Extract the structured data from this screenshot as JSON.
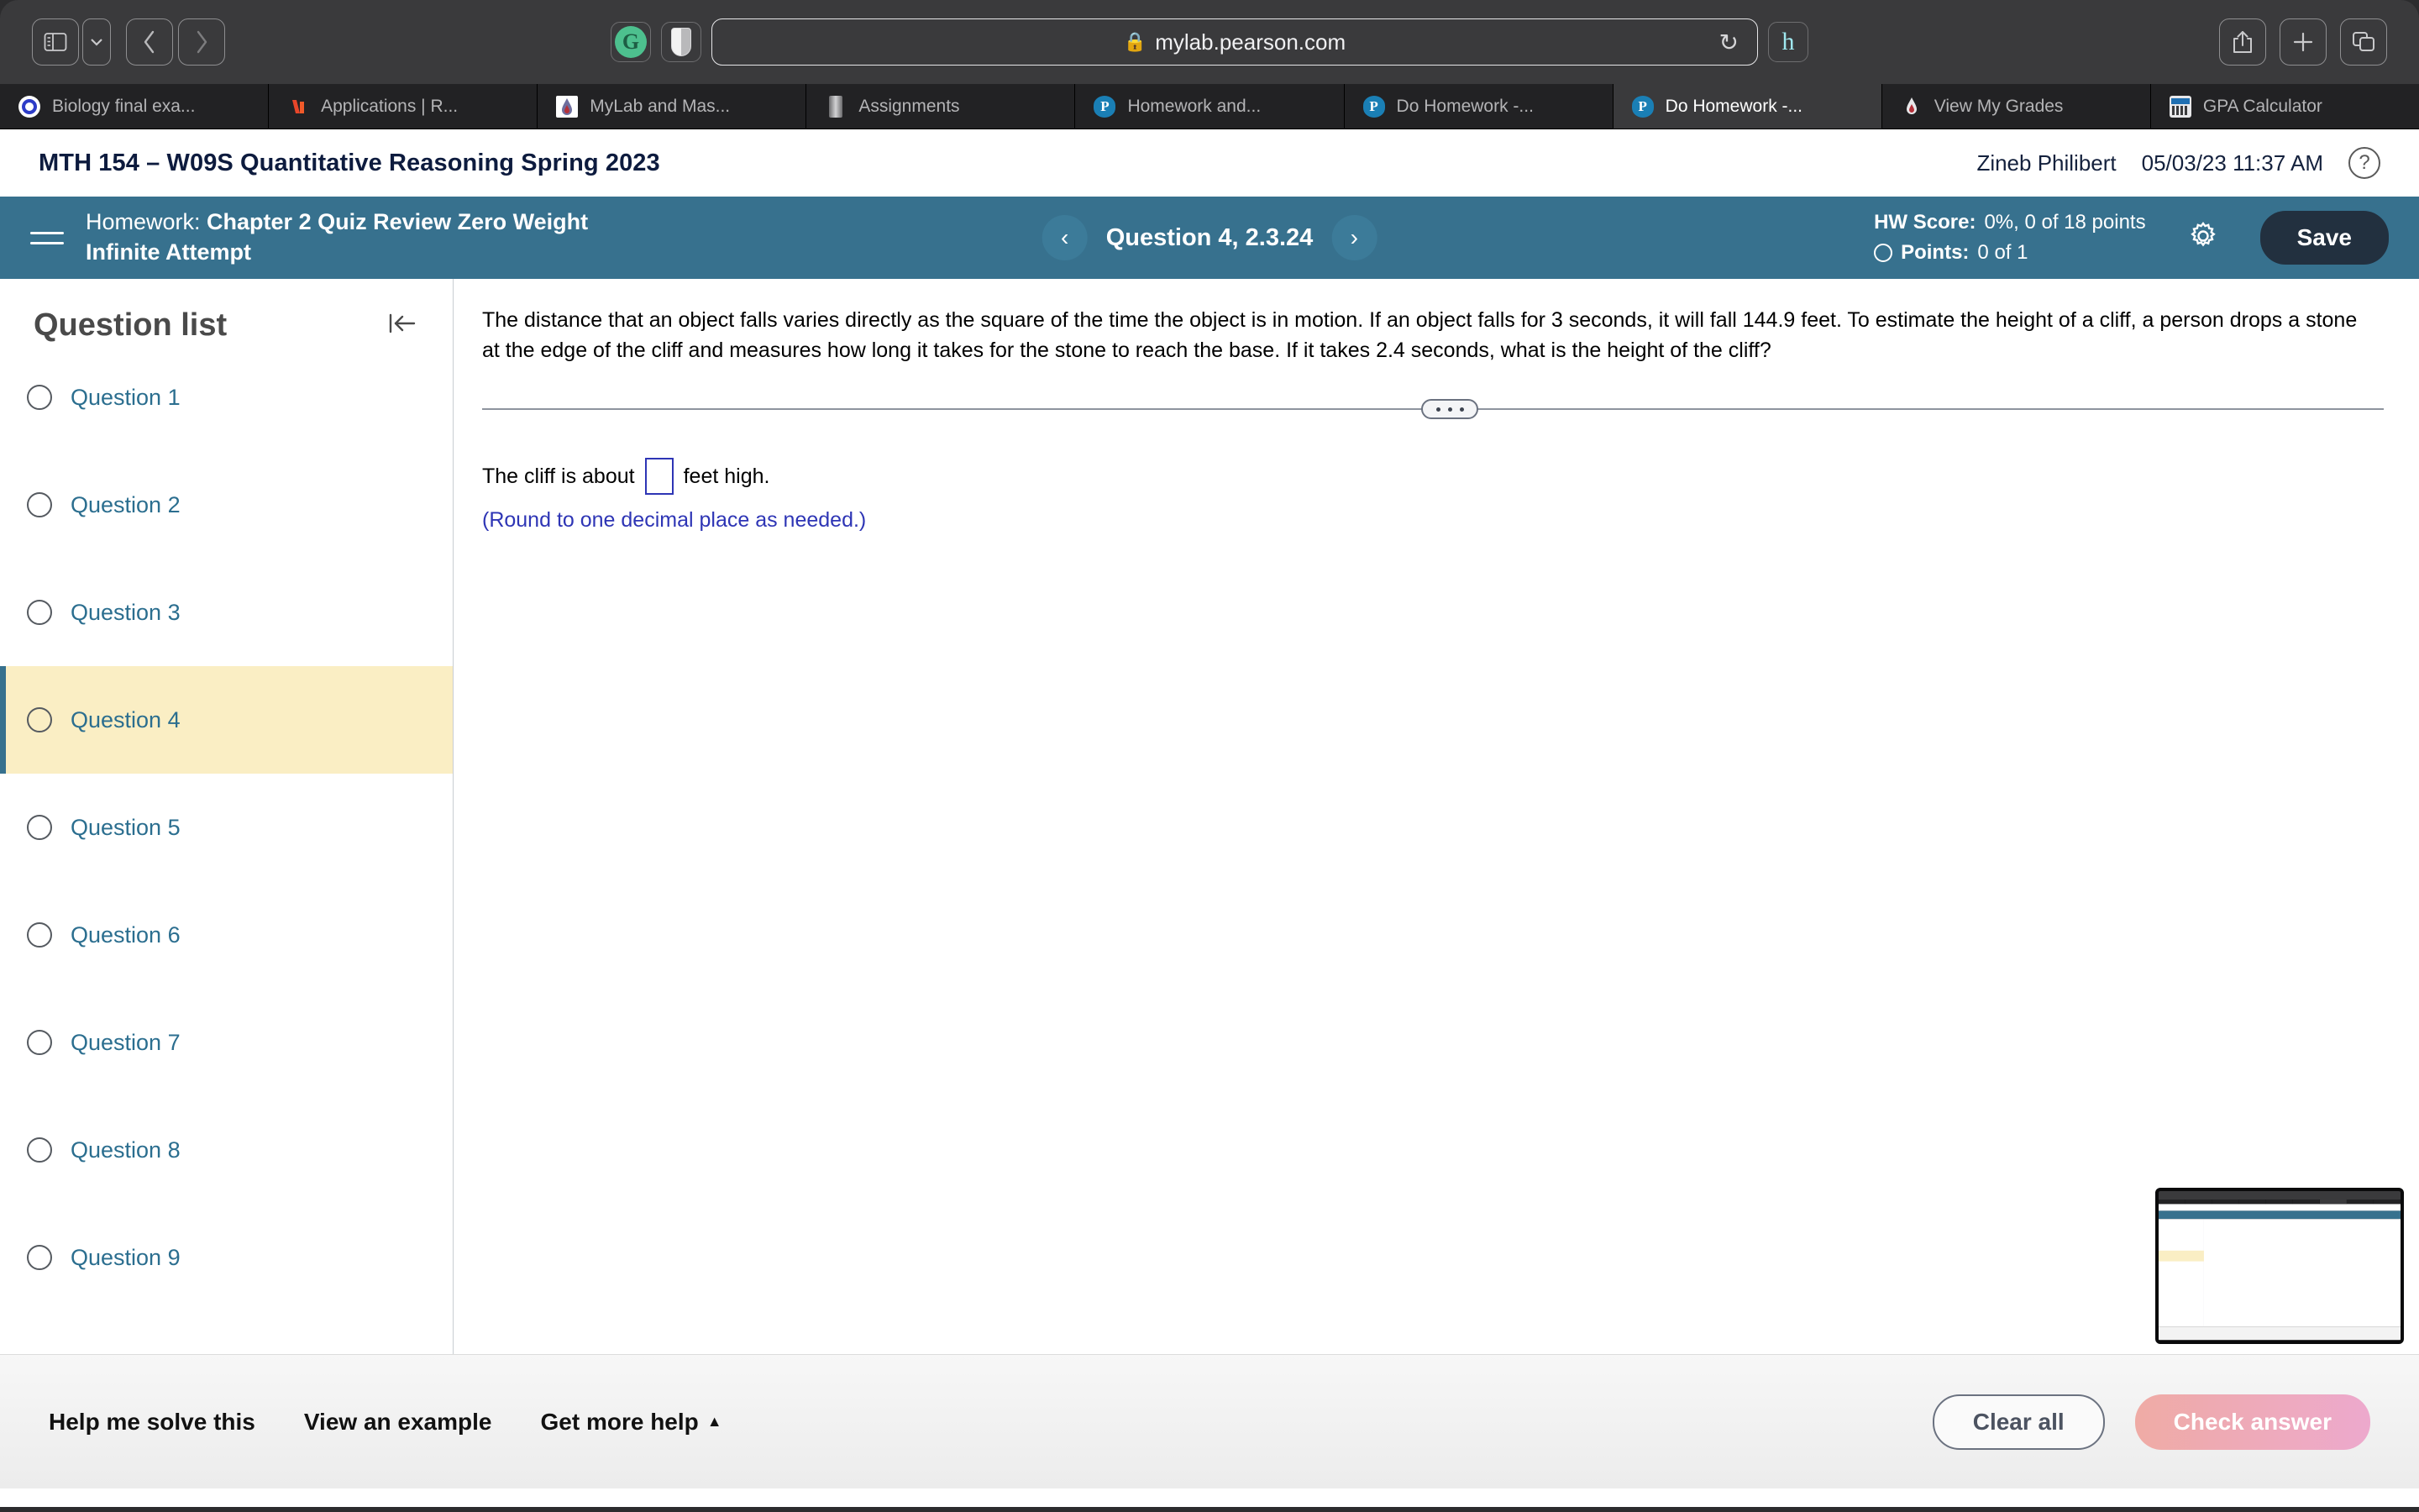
{
  "browser": {
    "url": "mylab.pearson.com",
    "lock_icon": "lock-icon",
    "sidebar_toggle_icon": "sidebar-toggle-icon",
    "sidebar_dropdown_icon": "chevron-down-icon",
    "back_icon": "chevron-left-icon",
    "forward_icon": "chevron-right-icon",
    "grammarly_icon": "grammarly-extension-icon",
    "grammarly_glyph": "G",
    "shield_icon": "privacy-shield-icon",
    "reload_icon": "reload-icon",
    "reload_glyph": "↻",
    "honey_icon": "honey-extension-icon",
    "honey_glyph": "h",
    "share_icon": "share-icon",
    "newtab_icon": "new-tab-icon",
    "tabs_overview_icon": "tab-overview-icon",
    "tabs": [
      {
        "label": "Biology final exa...",
        "icon": "quizlet-favicon",
        "active": false
      },
      {
        "label": "Applications | R...",
        "icon": "rstudio-favicon",
        "active": false
      },
      {
        "label": "MyLab and Mas...",
        "icon": "mylab-favicon",
        "active": false
      },
      {
        "label": "Assignments",
        "icon": "document-favicon",
        "active": false
      },
      {
        "label": "Homework and...",
        "icon": "pearson-favicon",
        "active": false
      },
      {
        "label": "Do Homework -...",
        "icon": "pearson-favicon",
        "active": false
      },
      {
        "label": "Do Homework -...",
        "icon": "pearson-favicon",
        "active": true
      },
      {
        "label": "View My Grades",
        "icon": "flame-favicon",
        "active": false
      },
      {
        "label": "GPA Calculator",
        "icon": "calculator-favicon",
        "active": false
      }
    ]
  },
  "course_header": {
    "title": "MTH 154 – W09S Quantitative Reasoning Spring 2023",
    "user_name": "Zineb Philibert",
    "date_time": "05/03/23 11:37 AM",
    "help_icon": "help-icon",
    "help_glyph": "?"
  },
  "hw_toolbar": {
    "menu_icon": "hamburger-menu-icon",
    "homework_label": "Homework:",
    "homework_title": "Chapter 2 Quiz Review Zero Weight",
    "homework_subtitle": "Infinite Attempt",
    "prev_icon": "chevron-left-icon",
    "prev_glyph": "‹",
    "next_icon": "chevron-right-icon",
    "next_glyph": "›",
    "question_label": "Question 4, 2.3.24",
    "hw_score_label": "HW Score:",
    "hw_score_value": "0%, 0 of 18 points",
    "points_label": "Points:",
    "points_value": "0 of 1",
    "settings_icon": "gear-icon",
    "save_label": "Save",
    "accent_color": "#37718e",
    "save_bg_color": "#22303f"
  },
  "question_list": {
    "title": "Question list",
    "collapse_icon": "collapse-panel-icon",
    "items": [
      {
        "label": "Question 1",
        "active": false
      },
      {
        "label": "Question 2",
        "active": false
      },
      {
        "label": "Question 3",
        "active": false
      },
      {
        "label": "Question 4",
        "active": true
      },
      {
        "label": "Question 5",
        "active": false
      },
      {
        "label": "Question 6",
        "active": false
      },
      {
        "label": "Question 7",
        "active": false
      },
      {
        "label": "Question 8",
        "active": false
      },
      {
        "label": "Question 9",
        "active": false
      }
    ],
    "highlight_color": "#faeec4",
    "link_color": "#2b6e8f"
  },
  "question": {
    "prompt": "The distance that an object falls varies directly as the square of the time the object is in motion. If an object falls for 3 seconds, it will fall 144.9 feet. To estimate the height of a cliff, a person drops a stone at the edge of the cliff and measures how long it takes for the stone to reach the base. If it takes 2.4 seconds, what is the height of the cliff?",
    "divider_handle_icon": "drag-handle-dots-icon",
    "answer_prefix": "The cliff is about",
    "answer_suffix": "feet high.",
    "answer_value": "",
    "answer_placeholder": "",
    "rounding_note": "(Round to one decimal place as needed.)",
    "note_color": "#2e35b5"
  },
  "footer": {
    "help_me_solve": "Help me solve this",
    "view_example": "View an example",
    "get_more_help": "Get more help",
    "get_more_help_icon": "caret-up-icon",
    "get_more_help_glyph": "▲",
    "clear_all": "Clear all",
    "check_answer": "Check answer",
    "check_answer_color": "#eda9cd"
  },
  "thumbnail": {
    "name": "screenshot-preview-thumbnail"
  }
}
